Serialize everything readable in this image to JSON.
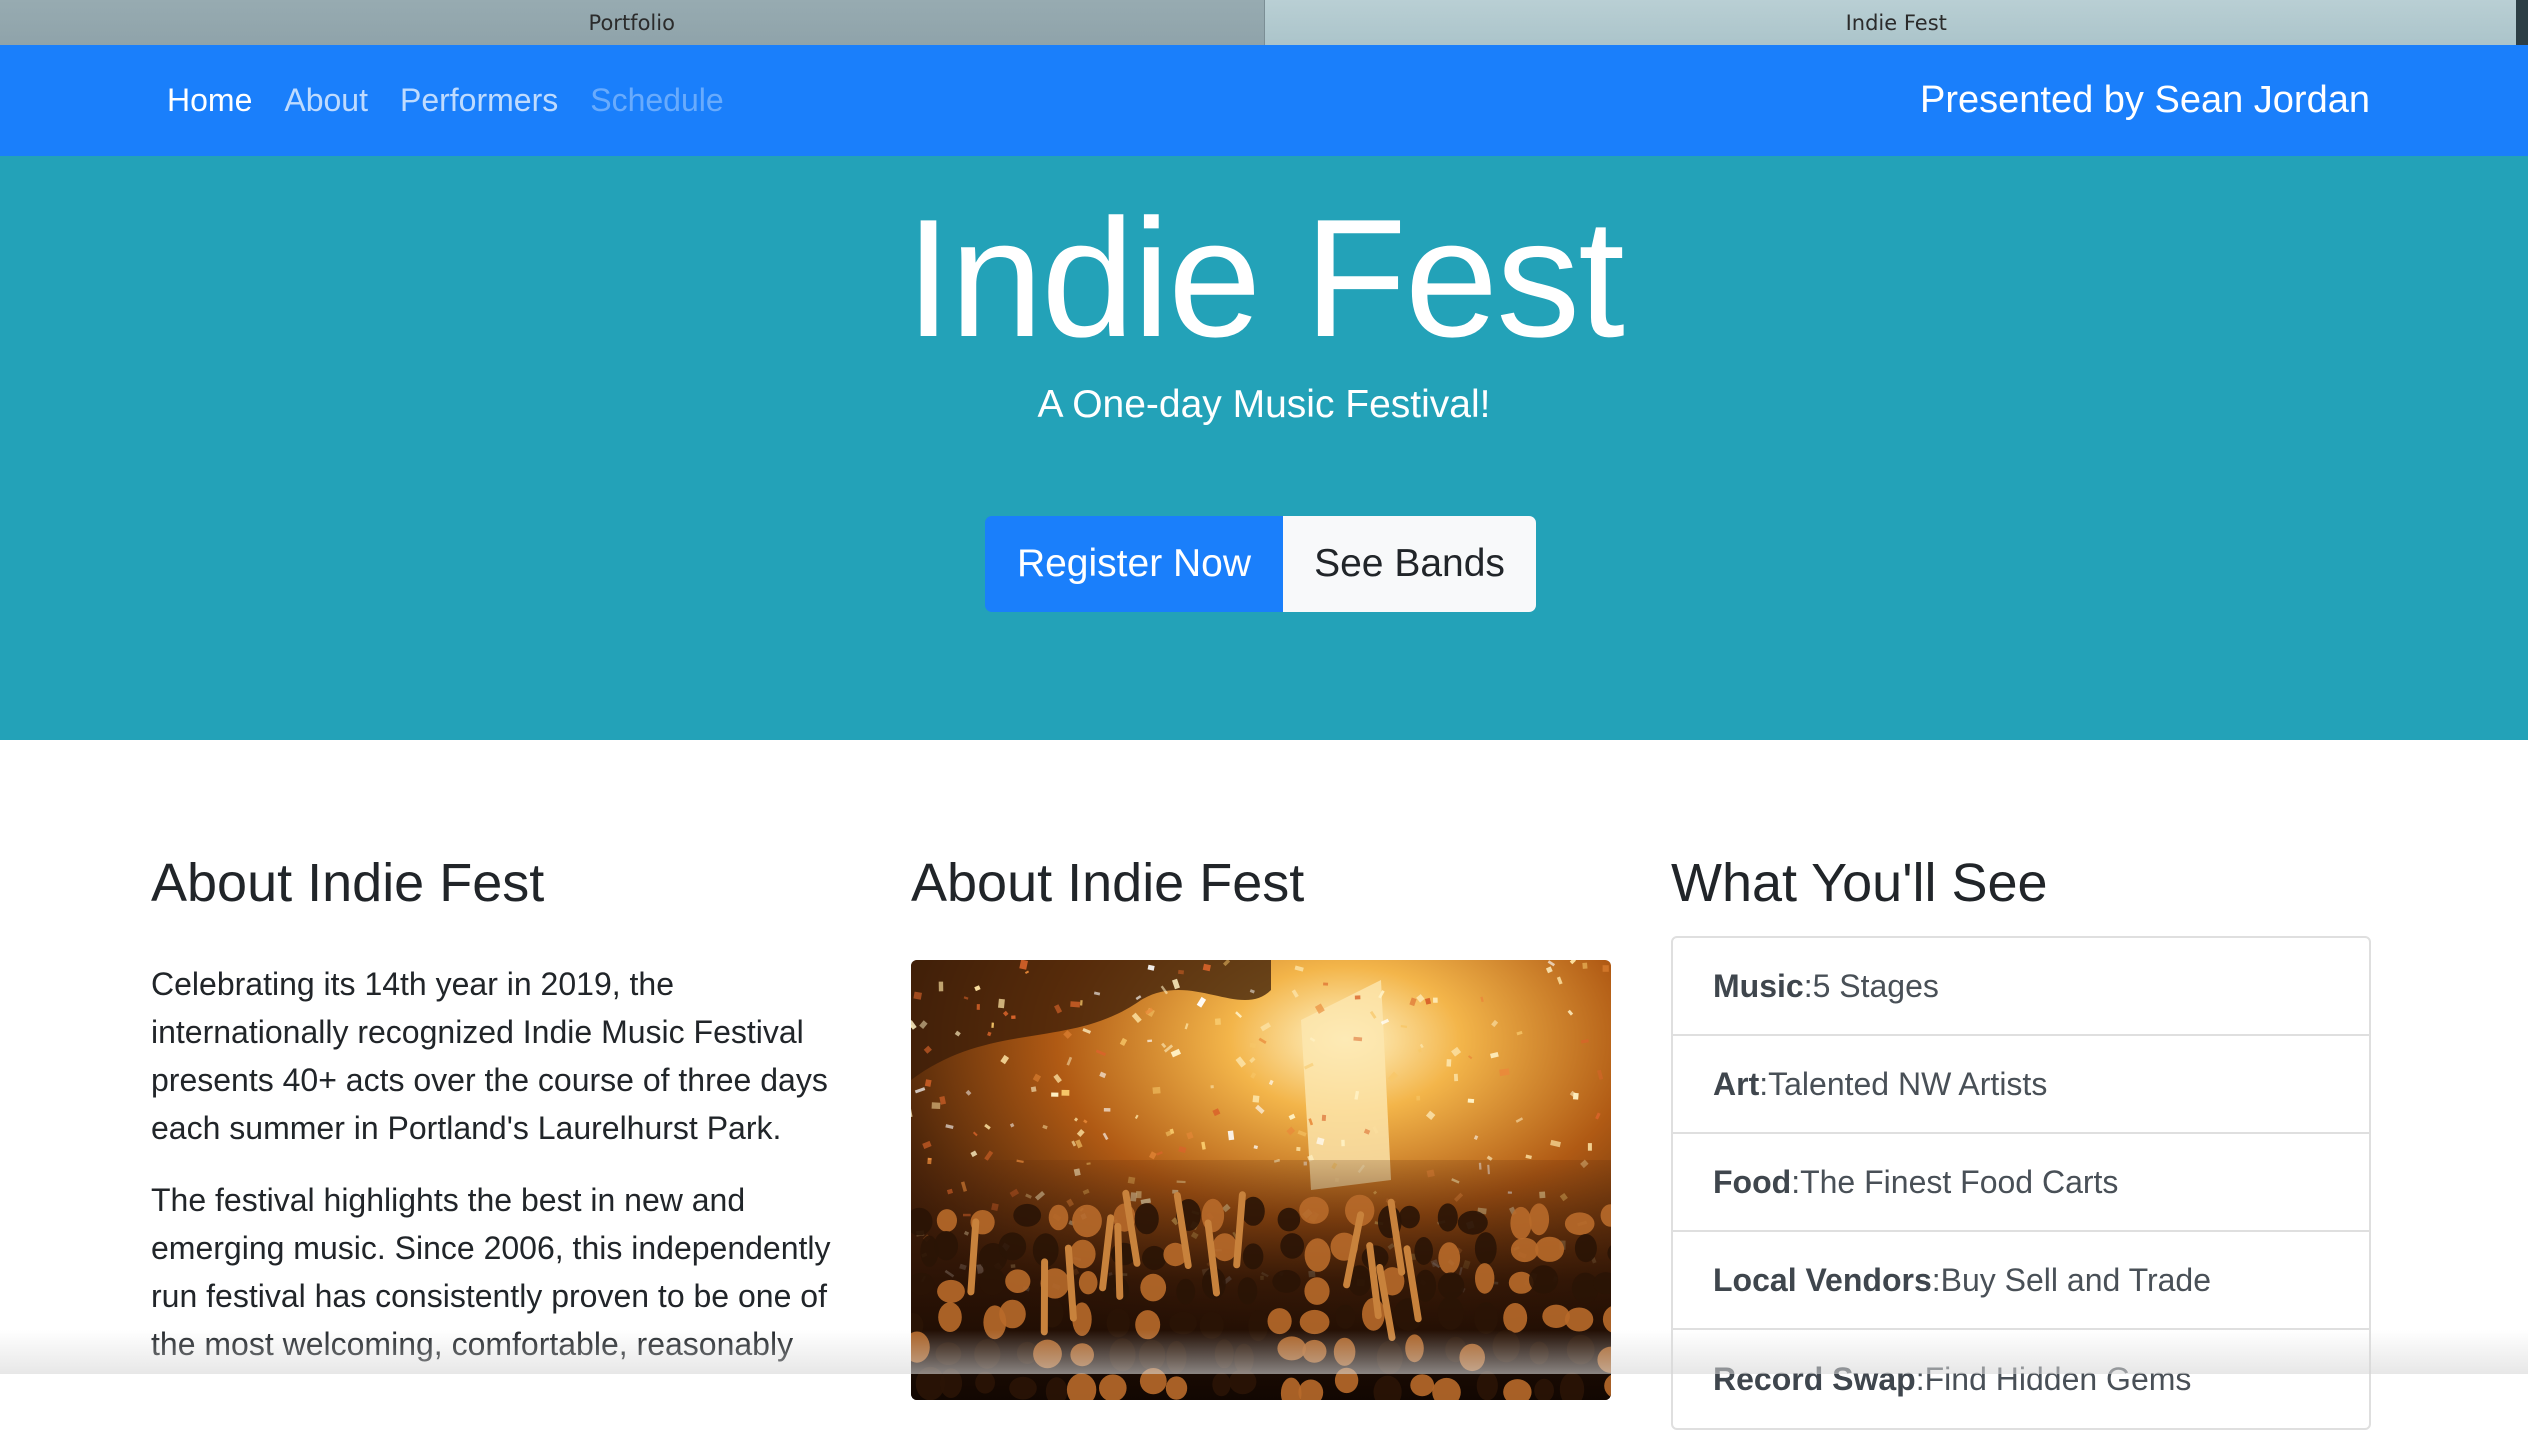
{
  "browser": {
    "tabs": [
      {
        "label": "Portfolio",
        "active": false
      },
      {
        "label": "Indie Fest",
        "active": true
      }
    ]
  },
  "navbar": {
    "links": [
      {
        "label": "Home",
        "state": "active"
      },
      {
        "label": "About",
        "state": "normal"
      },
      {
        "label": "Performers",
        "state": "normal"
      },
      {
        "label": "Schedule",
        "state": "disabled"
      }
    ],
    "brand": "Presented by Sean Jordan",
    "color": "#1a7ffb"
  },
  "hero": {
    "title": "Indie Fest",
    "subtitle": "A One-day Music Festival!",
    "primary_button": "Register Now",
    "secondary_button": "See Bands",
    "background": "#23a2b8"
  },
  "about": {
    "heading": "About Indie Fest",
    "paragraphs": [
      "Celebrating its 14th year in 2019, the internationally recognized Indie Music Festival presents 40+ acts over the course of three days each summer in Portland's Laurelhurst Park.",
      "The festival highlights the best in new and emerging music. Since 2006, this independently run festival has consistently proven to be one of the most welcoming, comfortable, reasonably"
    ]
  },
  "gallery": {
    "heading": "About Indie Fest",
    "image_subject": "concert crowd with confetti"
  },
  "features": {
    "heading": "What You'll See",
    "items": [
      {
        "label": "Music",
        "sep": ": ",
        "value": "5 Stages"
      },
      {
        "label": "Art",
        "sep": ": ",
        "value": "Talented NW Artists"
      },
      {
        "label": "Food",
        "sep": ": ",
        "value": "The Finest Food Carts"
      },
      {
        "label": "Local Vendors",
        "sep": ": ",
        "value": "Buy Sell and Trade"
      },
      {
        "label": "Record Swap ",
        "sep": ": ",
        "value": "Find Hidden Gems"
      }
    ]
  }
}
